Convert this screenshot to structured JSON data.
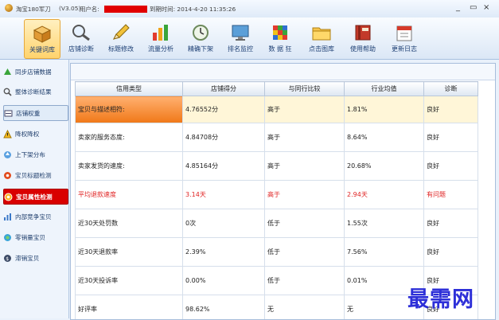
{
  "titlebar": {
    "app_name": "淘宝180军刀",
    "version": "(V3.05)",
    "user_label": "用户名:",
    "expiry": "到期时间: 2014-4-20 11:35:26",
    "controls": [
      "_",
      "▭",
      "×"
    ]
  },
  "toolbar": {
    "items": [
      {
        "label": "关键词库",
        "icon": "box-icon",
        "active": true
      },
      {
        "label": "店铺诊断",
        "icon": "magnifier-icon"
      },
      {
        "label": "标题修改",
        "icon": "pencil-icon"
      },
      {
        "label": "流量分析",
        "icon": "bar-chart-icon"
      },
      {
        "label": "精确下架",
        "icon": "clock-icon"
      },
      {
        "label": "排名监控",
        "icon": "monitor-icon"
      },
      {
        "label": "数 据 狂",
        "icon": "cube-icon"
      },
      {
        "label": "点击图库",
        "icon": "folder-icon"
      },
      {
        "label": "使用帮助",
        "icon": "book-icon"
      },
      {
        "label": "更新日志",
        "icon": "calendar-icon"
      }
    ]
  },
  "sidebar": {
    "items": [
      {
        "label": "同步店铺数据",
        "icon": "sync-icon"
      },
      {
        "label": "整体诊断结果",
        "icon": "search-icon"
      },
      {
        "label": "店铺权重",
        "icon": "weight-icon"
      },
      {
        "label": "降权降权",
        "icon": "warning-icon"
      },
      {
        "label": "上下架分布",
        "icon": "updown-icon"
      },
      {
        "label": "宝贝标题检测",
        "icon": "title-check-icon"
      },
      {
        "label": "宝贝属性检测",
        "icon": "attribute-check-icon"
      },
      {
        "label": "内部竞争宝贝",
        "icon": "compete-icon"
      },
      {
        "label": "零销量宝贝",
        "icon": "zero-sales-icon"
      },
      {
        "label": "滞销宝贝",
        "icon": "slow-sales-icon"
      }
    ]
  },
  "table": {
    "columns": [
      "信用类型",
      "店铺得分",
      "与同行比较",
      "行业均值",
      "诊断"
    ],
    "rows": [
      [
        "宝贝与描述相符:",
        "4.76552分",
        "高于",
        "1.81%",
        "良好"
      ],
      [
        "卖家的服务态度:",
        "4.84708分",
        "高于",
        "8.64%",
        "良好"
      ],
      [
        "卖家发货的速度:",
        "4.85164分",
        "高于",
        "20.68%",
        "良好"
      ],
      [
        "平均退款速度",
        "3.14天",
        "高于",
        "2.94天",
        "有问题"
      ],
      [
        "近30天处罚数",
        "0次",
        "低于",
        "1.55次",
        "良好"
      ],
      [
        "近30天退款率",
        "2.39%",
        "低于",
        "7.56%",
        "良好"
      ],
      [
        "近30天投诉率",
        "0.00%",
        "低于",
        "0.01%",
        "良好"
      ],
      [
        "好评率",
        "98.62%",
        "无",
        "无",
        "良好"
      ]
    ]
  },
  "watermark": "最需网",
  "colors": {
    "accent": "#f07818",
    "warn": "#e02424",
    "selected_side": "#d90000"
  }
}
